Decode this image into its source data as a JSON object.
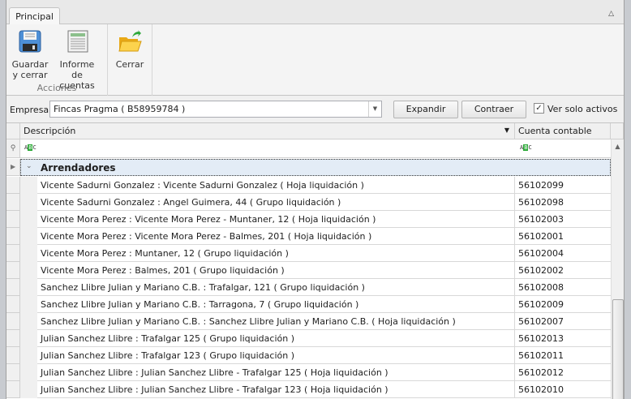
{
  "ribbon": {
    "tab": "Principal",
    "group_label": "Acciones",
    "buttons": {
      "save": "Guardar y cerrar",
      "report": "Informe de cuentas",
      "close": "Cerrar"
    }
  },
  "empresa": {
    "label": "Empresa:",
    "value": "Fincas Pragma ( B58959784 )",
    "expand": "Expandir",
    "collapse": "Contraer",
    "active_only": "Ver solo activos",
    "active_only_checked": true
  },
  "grid": {
    "columns": [
      "Descripción",
      "Cuenta contable"
    ],
    "group": "Arrendadores",
    "rows": [
      {
        "desc": "Vicente Sadurni Gonzalez : Vicente Sadurni Gonzalez ( Hoja liquidación )",
        "acct": "56102099"
      },
      {
        "desc": "Vicente Sadurni Gonzalez : Angel Guimera, 44 ( Grupo liquidación )",
        "acct": "56102098"
      },
      {
        "desc": "Vicente Mora Perez : Vicente Mora Perez - Muntaner, 12 ( Hoja liquidación )",
        "acct": "56102003"
      },
      {
        "desc": "Vicente Mora Perez : Vicente Mora Perez - Balmes, 201 ( Hoja liquidación )",
        "acct": "56102001"
      },
      {
        "desc": "Vicente Mora Perez : Muntaner, 12 ( Grupo liquidación )",
        "acct": "56102004"
      },
      {
        "desc": "Vicente Mora Perez : Balmes, 201 ( Grupo liquidación )",
        "acct": "56102002"
      },
      {
        "desc": "Sanchez Llibre Julian y Mariano C.B. : Trafalgar, 121 ( Grupo liquidación )",
        "acct": "56102008"
      },
      {
        "desc": "Sanchez Llibre Julian y Mariano C.B. : Tarragona, 7 ( Grupo liquidación )",
        "acct": "56102009"
      },
      {
        "desc": "Sanchez Llibre Julian y Mariano C.B. : Sanchez Llibre Julian y Mariano C.B. ( Hoja liquidación )",
        "acct": "56102007"
      },
      {
        "desc": "Julian Sanchez Llibre : Trafalgar 125 ( Grupo liquidación )",
        "acct": "56102013"
      },
      {
        "desc": "Julian Sanchez Llibre : Trafalgar 123 ( Grupo liquidación )",
        "acct": "56102011"
      },
      {
        "desc": "Julian Sanchez Llibre : Julian Sanchez Llibre - Trafalgar 125 ( Hoja liquidación )",
        "acct": "56102012"
      },
      {
        "desc": "Julian Sanchez Llibre : Julian Sanchez Llibre - Trafalgar 123 ( Hoja liquidación )",
        "acct": "56102010"
      }
    ]
  }
}
